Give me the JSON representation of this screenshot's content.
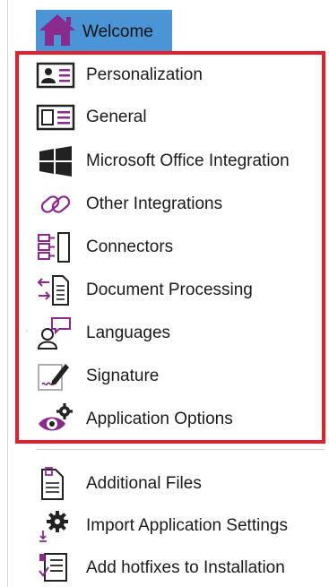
{
  "welcome": {
    "label": "Welcome",
    "icon": "home-icon"
  },
  "settings": [
    {
      "label": "Personalization",
      "icon": "user-card-icon"
    },
    {
      "label": "General",
      "icon": "general-settings-icon"
    },
    {
      "label": "Microsoft Office Integration",
      "icon": "windows-logo-icon"
    },
    {
      "label": "Other Integrations",
      "icon": "chain-link-icon"
    },
    {
      "label": "Connectors",
      "icon": "connectors-icon"
    },
    {
      "label": "Document Processing",
      "icon": "document-arrows-icon"
    },
    {
      "label": "Languages",
      "icon": "speech-person-icon"
    },
    {
      "label": "Signature",
      "icon": "pen-signature-icon"
    },
    {
      "label": "Application Options",
      "icon": "eye-gear-icon"
    }
  ],
  "extras": [
    {
      "label": "Additional Files",
      "icon": "files-icon"
    },
    {
      "label": "Import Application Settings",
      "icon": "gear-import-icon"
    },
    {
      "label": "Add hotfixes to Installation",
      "icon": "hotfix-list-icon"
    }
  ],
  "colors": {
    "selection": "#4a95d6",
    "highlight_border": "#e0202c",
    "accent_purple": "#8a2a8c"
  }
}
